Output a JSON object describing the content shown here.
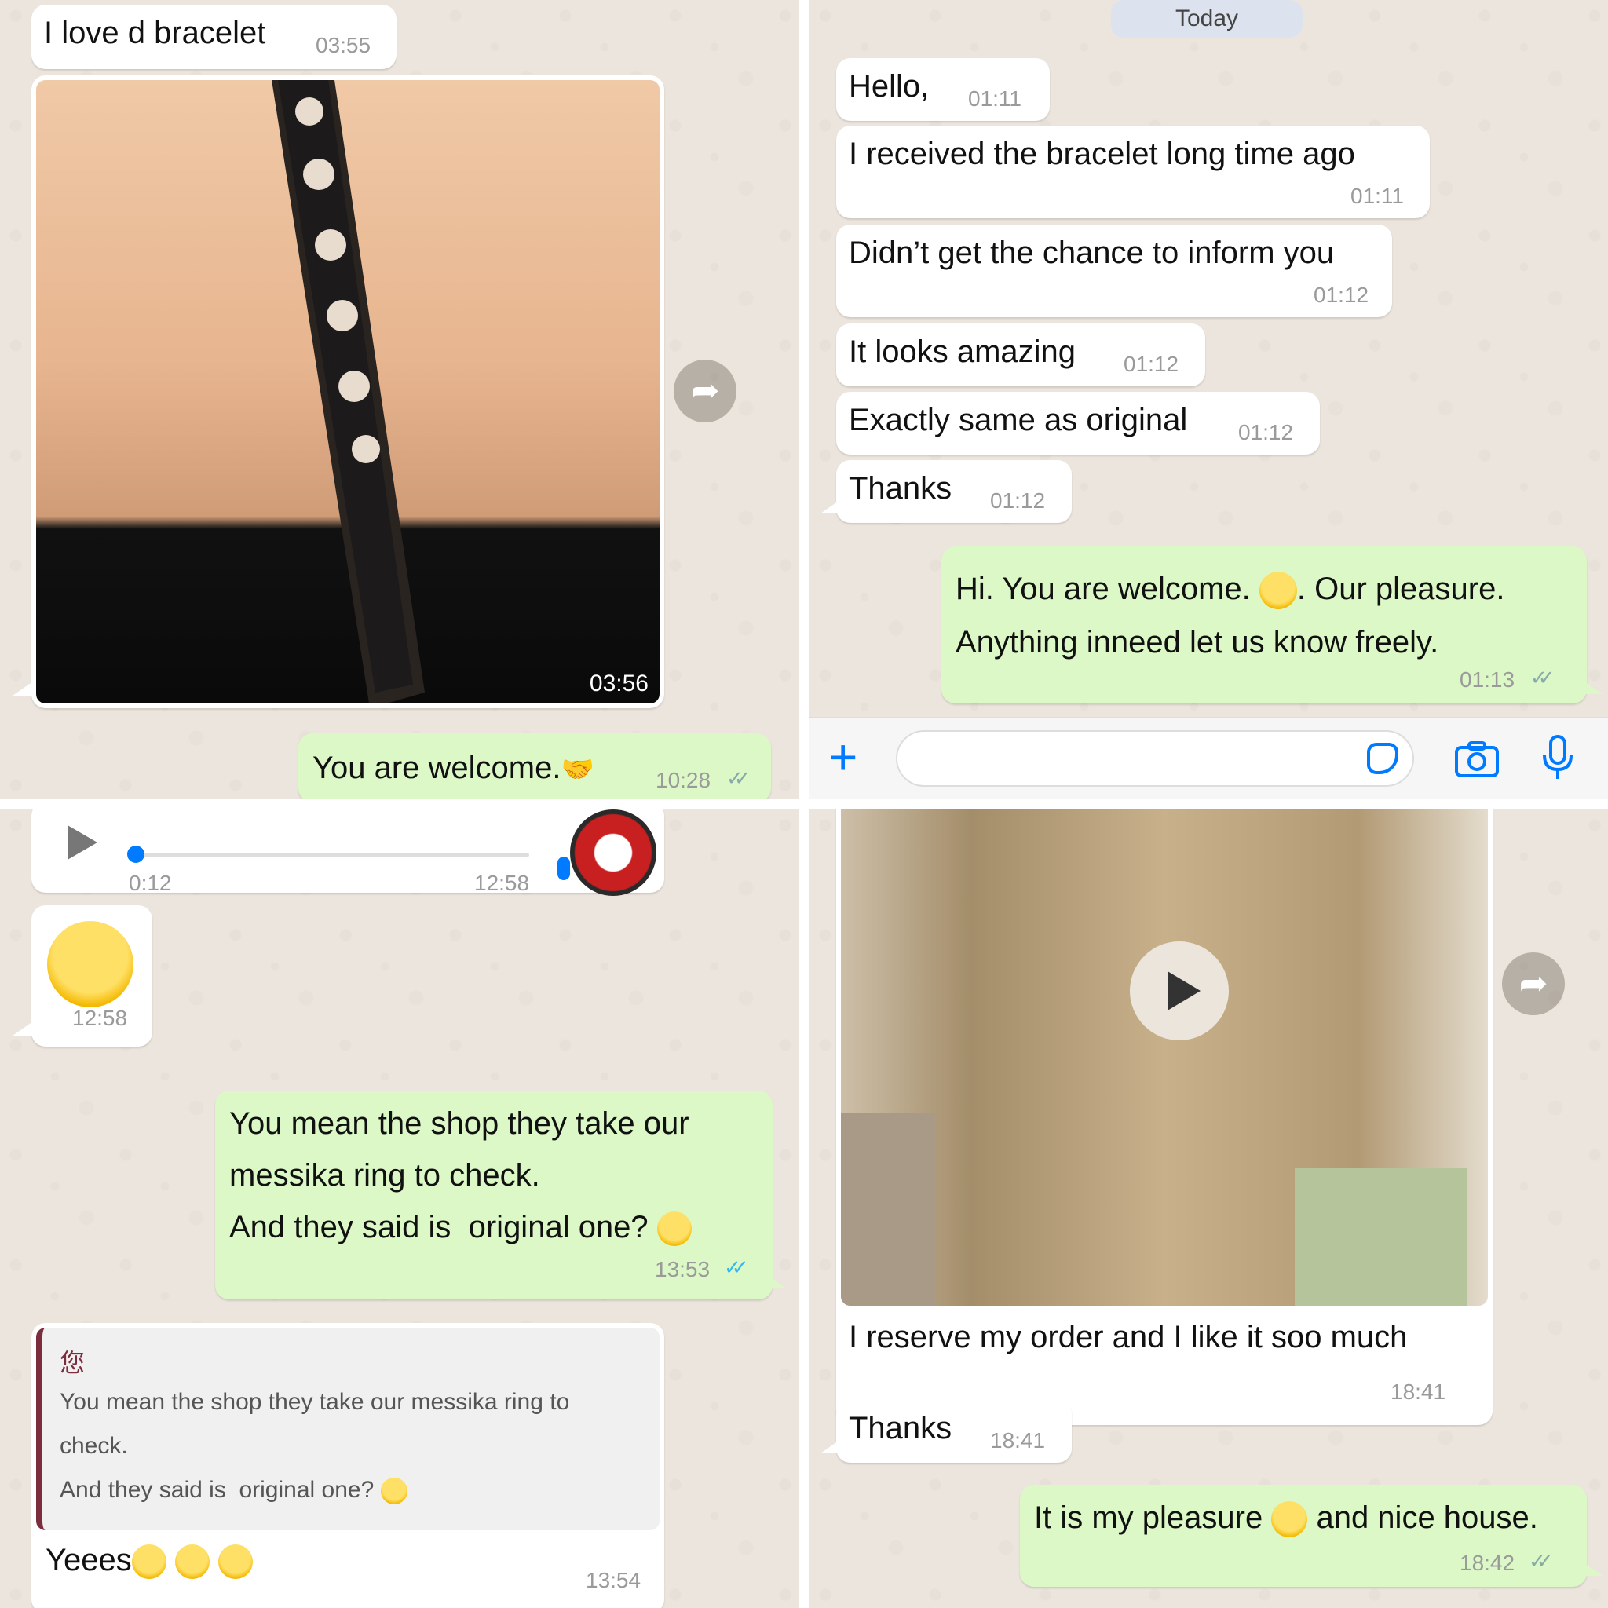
{
  "panel1": {
    "msg1": {
      "text": "I love d bracelet",
      "time": "03:55"
    },
    "photo": {
      "time": "03:56",
      "icon": "forward-icon"
    },
    "msg2": {
      "text": "You are welcome.",
      "time": "10:28",
      "emoji": "handshake"
    }
  },
  "panel2": {
    "date_pill": "Today",
    "messages": [
      {
        "text": "Hello,",
        "time": "01:11"
      },
      {
        "text": "I received the bracelet long time ago",
        "time": "01:11"
      },
      {
        "text": "Didn’t get the chance to inform you",
        "time": "01:12"
      },
      {
        "text": "It looks amazing",
        "time": "01:12"
      },
      {
        "text": "Exactly same as original",
        "time": "01:12"
      },
      {
        "text": "Thanks",
        "time": "01:12"
      }
    ],
    "reply": {
      "line1_a": "Hi. You are welcome. ",
      "line1_b": ". Our pleasure.",
      "line2": "Anything inneed let us know freely.",
      "time": "01:13"
    },
    "input_bar": {
      "placeholder": "",
      "icons": [
        "plus-icon",
        "sticker-icon",
        "camera-icon",
        "microphone-icon"
      ]
    }
  },
  "panel3": {
    "voice": {
      "duration": "0:12",
      "time": "12:58",
      "progress": 0.0
    },
    "emoji_msg": {
      "emoji": "face-with-tears-of-joy",
      "time": "12:58"
    },
    "msg": {
      "lines": [
        "You mean the shop they take our",
        "messika ring to check.",
        "And they said is  original one?"
      ],
      "time": "13:53"
    },
    "reply": {
      "quote_author": "您",
      "quote_lines": [
        "You mean the shop they take our messika ring to",
        "check.",
        "And they said is  original one?"
      ],
      "text": "Yeees",
      "time": "13:54"
    }
  },
  "panel4": {
    "video": {
      "caption": "I reserve my order and I like it soo much",
      "time": "18:41"
    },
    "msg1": {
      "text": "Thanks",
      "time": "18:41"
    },
    "msg2": {
      "text_a": "It is my pleasure ",
      "text_b": "and nice house.",
      "time": "18:42"
    }
  },
  "colors": {
    "incoming": "#ffffff",
    "outgoing": "#dcf8c6",
    "wallpaper": "#ece5dd",
    "accent": "#007aff"
  }
}
